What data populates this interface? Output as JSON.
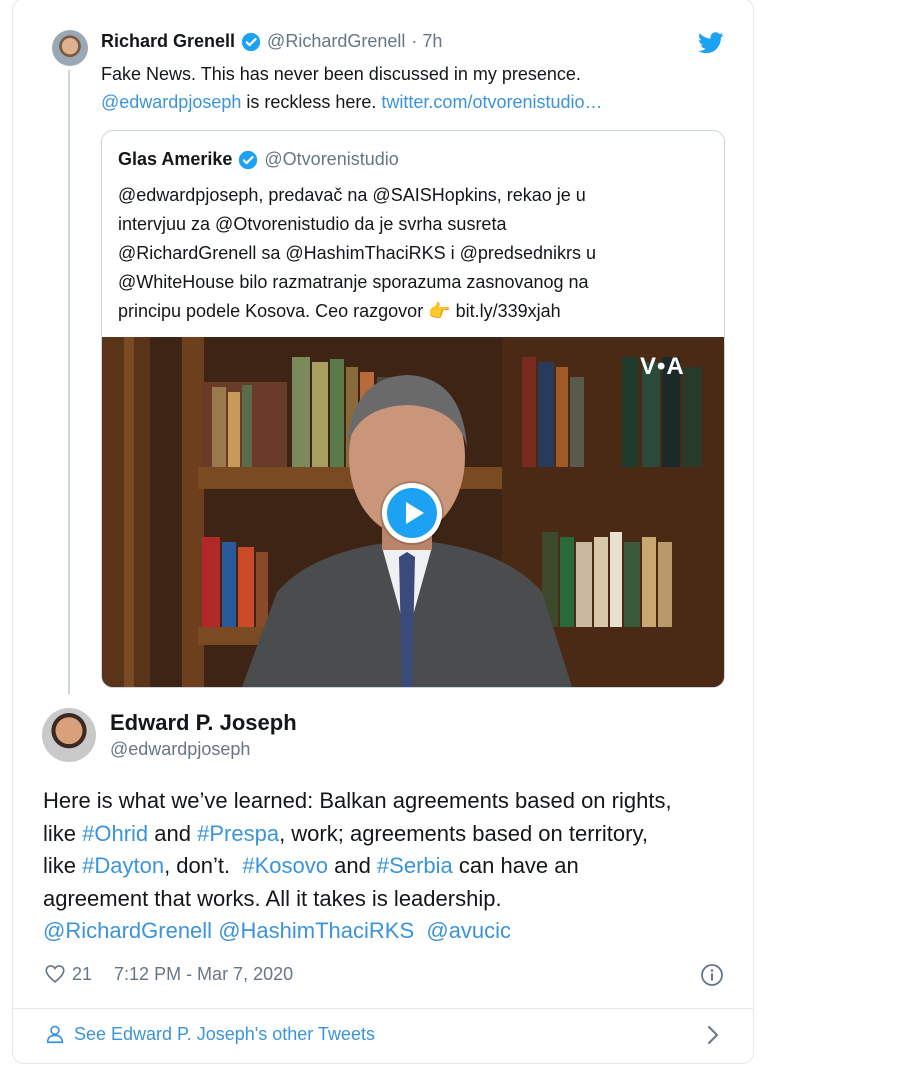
{
  "parent_tweet": {
    "author_name": "Richard Grenell",
    "author_handle": "@RichardGrenell",
    "dot_time": "· 7h",
    "line1": "Fake News. This has never been discussed in my presence.",
    "mention": "@edwardpjoseph",
    "line2_rest": " is reckless here. ",
    "link": "twitter.com/otvorenistudio…"
  },
  "quoted_tweet": {
    "author_name": "Glas Amerike",
    "author_handle": "@Otvorenistudio",
    "lines": [
      "@edwardpjoseph, predavač na @SAISHopkins, rekao je u",
      "intervjuu za @Otvorenistudio da je svrha susreta",
      "@RichardGrenell sa @HashimThaciRKS i @predsednikrs u",
      "@WhiteHouse bilo razmatranje sporazuma zasnovanog na"
    ],
    "last_line_text": "principu podele Kosova. Ceo razgovor ",
    "pointing_emoji": "👉",
    "short_link": " bit.ly/339xjah",
    "video_logo": "V•A"
  },
  "main_tweet": {
    "author_name": "Edward P. Joseph",
    "author_handle": "@edwardpjoseph",
    "t1": "Here is what we’ve learned: Balkan agreements based on rights,",
    "t2a": "like ",
    "h_ohrid": "#Ohrid",
    "t2b": " and ",
    "h_prespa": "#Prespa",
    "t2c": ", work; agreements based on territory,",
    "t3a": "like ",
    "h_dayton": "#Dayton",
    "t3b": ", don’t.  ",
    "h_kosovo": "#Kosovo",
    "t3c": " and ",
    "h_serbia": "#Serbia",
    "t3d": " can have an",
    "t4": "agreement that works. All it takes is leadership.",
    "m1": "@RichardGrenell",
    "m2": "@HashimThaciRKS",
    "m3": "@avucic"
  },
  "meta": {
    "likes": "21",
    "timestamp": "7:12 PM - Mar 7, 2020"
  },
  "footer": {
    "label": "See Edward P. Joseph's other Tweets"
  },
  "colors": {
    "link": "#3b94d9",
    "verified": "#1da1f2",
    "twitter_brand": "#1da1f2"
  }
}
